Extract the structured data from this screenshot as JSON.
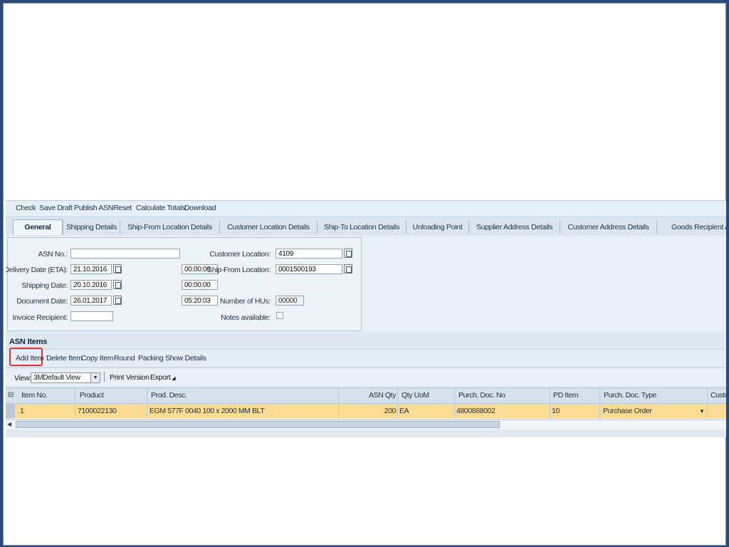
{
  "toolbar": {
    "check": "Check",
    "save_draft": "Save Draft",
    "publish": "Publish ASN",
    "reset": "Reset",
    "calculate": "Calculate Totals",
    "download": "Download"
  },
  "tabs": [
    "General",
    "Shipping Details",
    "Ship-From Location Details",
    "Customer Location Details",
    "Ship-To Location Details",
    "Unloading Point",
    "Supplier Address Details",
    "Customer Address Details",
    "Goods Recipient Add"
  ],
  "form": {
    "asn_no_label": "ASN No.:",
    "asn_no_value": "",
    "delivery_date_label": "Delivery Date (ETA):",
    "delivery_date_value": "21.10.2016",
    "delivery_time_value": "00:00:00",
    "shipping_date_label": "Shipping Date:",
    "shipping_date_value": "20.10.2016",
    "shipping_time_value": "00:00:00",
    "document_date_label": "Document Date:",
    "document_date_value": "26.01.2017",
    "document_time_value": "05:20:03",
    "invoice_recipient_label": "Invoice Recipient:",
    "invoice_recipient_value": "",
    "customer_location_label": "Customer Location:",
    "customer_location_value": "4109",
    "ship_from_label": "Ship-From Location:",
    "ship_from_value": "0001500193",
    "number_of_hus_label": "Number of HUs:",
    "number_of_hus_value": "00000",
    "notes_label": "Notes available:"
  },
  "items": {
    "section_title": "ASN Items",
    "add_item": "Add Item",
    "delete_item": "Delete Item",
    "copy_item": "Copy Item",
    "round": "Round",
    "packing": "Packing",
    "show_details": "Show Details",
    "view_label": "View:",
    "view_value": "3MDefault View",
    "print_version": "Print Version",
    "export": "Export"
  },
  "grid": {
    "columns": [
      "Item No.",
      "Product",
      "Prod. Desc.",
      "ASN Qty",
      "Qty UoM",
      "Purch. Doc. No",
      "PD Item",
      "Purch. Doc. Type",
      "Custo"
    ],
    "rows": [
      {
        "item_no": "1",
        "product": "7100022130",
        "desc": "EGM 577F 0040 100 x 2000 MM BLT",
        "qty": "200",
        "uom": "EA",
        "pd_no": "4800868002",
        "pd_item": "10",
        "pd_type": "Purchase Order"
      }
    ]
  },
  "colors": {
    "selected_row": "#fbdc94",
    "highlight": "#e0323a",
    "frame": "#2b4a78"
  }
}
